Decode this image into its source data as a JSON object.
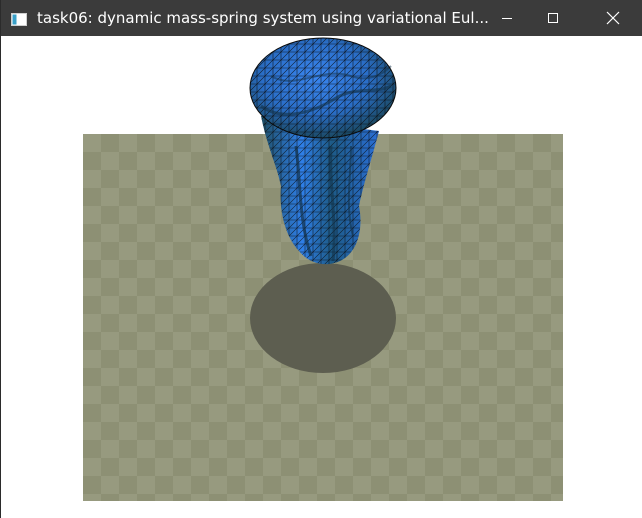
{
  "window": {
    "title": "task06: dynamic mass-spring system using variational Eul...",
    "icons": {
      "app": "app-window-icon",
      "minimize": "minimize-icon",
      "maximize": "maximize-icon",
      "close": "close-icon"
    },
    "colors": {
      "titlebar": "#3b3b3b",
      "title_text": "#ffffff",
      "background": "#ffffff"
    }
  },
  "scene": {
    "floor": {
      "pattern": "checkerboard",
      "color_light": "#979a7f",
      "color_dark": "#8d9074"
    },
    "shadow_color": "#5d5e50",
    "mesh": {
      "description_icon": "cloth-mesh",
      "color_fill": "#2b6fe0",
      "color_dark": "#1e4f6a",
      "edge_color": "#0a0a0a"
    }
  }
}
